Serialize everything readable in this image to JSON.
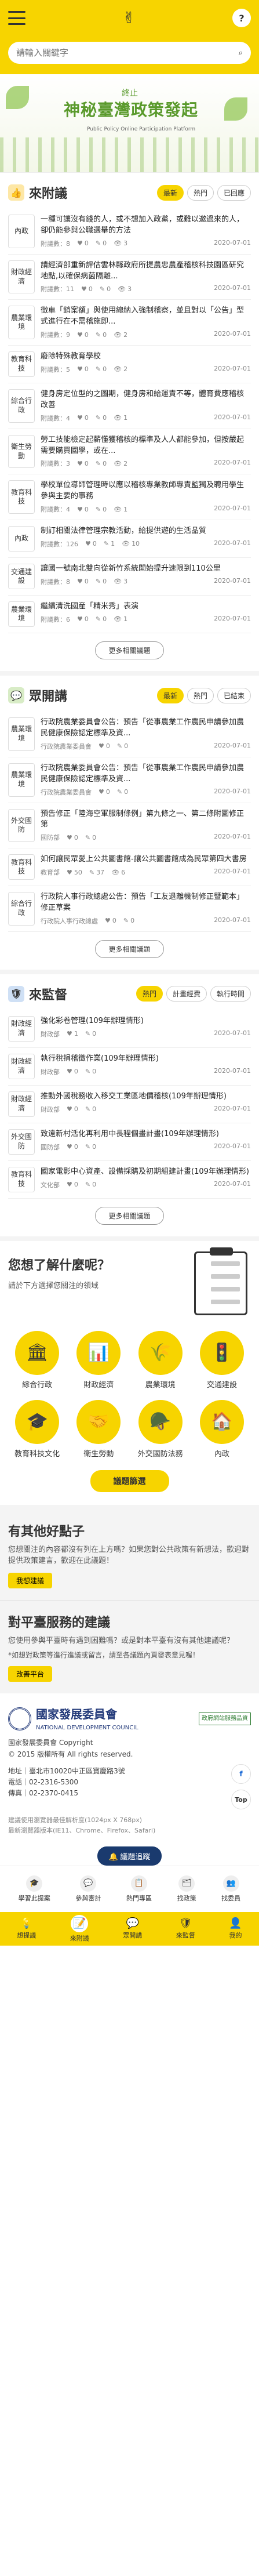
{
  "header": {
    "search_placeholder": "請輸入關鍵字",
    "login_label": "?"
  },
  "banner": {
    "title": "神秘臺灣政策發起",
    "small": "終止",
    "sub": "Public Policy Online Participation Platform"
  },
  "fuyi": {
    "title": "來附議",
    "tabs": [
      "最新",
      "熱門",
      "已回應"
    ],
    "more": "更多相關議題",
    "items": [
      {
        "cat": "內政",
        "title": "一種可讓沒有錢的人，或不想加入政黨，或難以邀過來的人，卻仍能參與公職選舉的方法",
        "user": "附議數：8",
        "a": "0",
        "b": "0",
        "c": "3",
        "date": "2020-07-01"
      },
      {
        "cat": "財政經濟",
        "title": "請經濟部重新評估雲林縣政府所提農忠農產稽核科技園區研究地點,以確保病菌隔離...",
        "user": "附議數：11",
        "a": "0",
        "b": "0",
        "c": "3",
        "date": "2020-07-01"
      },
      {
        "cat": "農業環境",
        "title": "徵車「銷案額」與使用總納入強制稽察，並且對以「公告」型式進行在不需稽施即...",
        "user": "附議數：9",
        "a": "0",
        "b": "0",
        "c": "2",
        "date": "2020-07-01"
      },
      {
        "cat": "教育科技",
        "title": "廢除特殊教育學校",
        "user": "附議數：5",
        "a": "0",
        "b": "0",
        "c": "2",
        "date": "2020-07-01"
      },
      {
        "cat": "綜合行政",
        "title": "健身房定位型的之圖期，健身房和給運責不等，體育費應稽核改善",
        "user": "附議數：4",
        "a": "0",
        "b": "0",
        "c": "1",
        "date": "2020-07-01"
      },
      {
        "cat": "衛生勞動",
        "title": "勞工技能檢定起薪懂獲稽核的標準及人人都能參加，但按嚴起需要購買國學，或在...",
        "user": "附議數：3",
        "a": "0",
        "b": "0",
        "c": "2",
        "date": "2020-07-01"
      },
      {
        "cat": "教育科技",
        "title": "學校單位導師管理時以應以稽核專業教師專責監獨及聘用學生參與主要的事務",
        "user": "附議數：4",
        "a": "0",
        "b": "0",
        "c": "1",
        "date": "2020-07-01"
      },
      {
        "cat": "內政",
        "title": "制訂相關法律管理宗教活動，給提供遊的生活品質",
        "user": "附議數：126",
        "a": "0",
        "b": "1",
        "c": "10",
        "date": "2020-07-01"
      },
      {
        "cat": "交通建設",
        "title": "讓國一號南北雙向從新竹系統開始提升速限到110公里",
        "user": "附議數：8",
        "a": "0",
        "b": "0",
        "c": "3",
        "date": "2020-07-01"
      },
      {
        "cat": "農業環境",
        "title": "繼續清洗國産「精米秀」表演",
        "user": "附議數：6",
        "a": "0",
        "b": "0",
        "c": "1",
        "date": "2020-07-01"
      }
    ]
  },
  "zhongyi": {
    "title": "眾開講",
    "tabs": [
      "最新",
      "熱門",
      "已結束"
    ],
    "more": "更多相關議題",
    "items": [
      {
        "cat": "農業環境",
        "title": "行政院農業委員會公告：預告「從事農業工作農民申請參加農民健康保險認定標準及資...",
        "user": "行政院農業委員會",
        "a": "0",
        "b": "0",
        "c": "",
        "date": "2020-07-01"
      },
      {
        "cat": "農業環境",
        "title": "行政院農業委員會公告：預告「從事農業工作農民申請參加農民健康保險認定標準及資...",
        "user": "行政院農業委員會",
        "a": "0",
        "b": "0",
        "c": "",
        "date": "2020-07-01"
      },
      {
        "cat": "外交國防",
        "title": "預告修正「陸海空軍服制條例」第九條之一、第二條附圖修正第",
        "user": "國防部",
        "a": "0",
        "b": "0",
        "c": "",
        "date": "2020-07-01"
      },
      {
        "cat": "教育科技",
        "title": "如何讓民眾愛上公共圖書館-讓公共圖書館成為民眾第四大書房",
        "user": "教育部",
        "a": "50",
        "b": "37",
        "c": "6",
        "date": "2020-07-01"
      },
      {
        "cat": "綜合行政",
        "title": "行政院人事行政總處公告：預告「工友退離機制修正暨範本」修正草案",
        "user": "行政院人事行政總處",
        "a": "0",
        "b": "0",
        "c": "",
        "date": "2020-07-01"
      }
    ]
  },
  "jiandu": {
    "title": "來監督",
    "tabs": [
      "熱門",
      "計畫經費",
      "執行時間"
    ],
    "more": "更多相關議題",
    "items": [
      {
        "cat": "財政經濟",
        "title": "強化彩卷管理(109年辦理情形)",
        "user": "財政部",
        "a": "1",
        "b": "0",
        "c": "",
        "date": "2020-07-01"
      },
      {
        "cat": "財政經濟",
        "title": "執行稅捐稽徵作業(109年辦理情形)",
        "user": "財政部",
        "a": "0",
        "b": "0",
        "c": "",
        "date": "2020-07-01"
      },
      {
        "cat": "財政經濟",
        "title": "推動外國稅務收入移交工業區地價稽核(109年辦理情形)",
        "user": "財政部",
        "a": "0",
        "b": "0",
        "c": "",
        "date": "2020-07-01"
      },
      {
        "cat": "外交國防",
        "title": "致遠新村活化再利用中長程個畫計畫(109年辦理情形)",
        "user": "國防部",
        "a": "0",
        "b": "0",
        "c": "",
        "date": "2020-07-01"
      },
      {
        "cat": "教育科技",
        "title": "國家電影中心資產、設備採購及初期組建計畫(109年辦理情形)",
        "user": "文化部",
        "a": "0",
        "b": "0",
        "c": "",
        "date": "2020-07-01"
      }
    ]
  },
  "know": {
    "title": "您想了解什麼呢？",
    "desc": "請於下方選擇您關注的領域",
    "cats": [
      {
        "icon": "🏛",
        "label": "綜合行政"
      },
      {
        "icon": "📊",
        "label": "財政經濟"
      },
      {
        "icon": "🌾",
        "label": "農業環境"
      },
      {
        "icon": "🚦",
        "label": "交通建設"
      },
      {
        "icon": "🎓",
        "label": "教育科技文化"
      },
      {
        "icon": "🤝",
        "label": "衛生勞動"
      },
      {
        "icon": "🪖",
        "label": "外交國防法務"
      },
      {
        "icon": "🏠",
        "label": "內政"
      }
    ],
    "button": "議題篩選"
  },
  "idea": {
    "title": "有其他好點子",
    "desc": "您想關注的內容都沒有列在上方嗎？如果您對公共政策有新想法，歡迎對提供政策建言，歡迎在此議題！",
    "button": "我想建議"
  },
  "suggest": {
    "title": "對平臺服務的建議",
    "desc": "您使用參與平臺時有遇到困難嗎？或是對本平臺有沒有其他建議呢？",
    "note": "*如想對政策等進行進議或留言，請至各議題內頁發表意見喔！",
    "button": "改善平台"
  },
  "footer": {
    "org": "國家發展委員會",
    "org_en": "NATIONAL DEVELOPMENT COUNCIL",
    "badge": "政府網站服務品質",
    "copy1": "國家發展委員會 Copyright",
    "copy2": "© 2015 版權所有 All rights reserved.",
    "addr": "地址｜臺北市10020中正區寶慶路3號",
    "tel": "電話｜02-2316-5300",
    "fax": "傳真｜02-2370-0415",
    "note": "建議使用瀏覽器最佳解析度(1024px X 768px)",
    "note2": "最新瀏覽器版本(IE11、Chrome、Firefox、Safari)",
    "tracker": "議題追蹤",
    "top": "Top"
  },
  "links": [
    {
      "icon": "🎓",
      "label": "學習此提案"
    },
    {
      "icon": "💬",
      "label": "參與審計"
    },
    {
      "icon": "📋",
      "label": "熱門專區"
    },
    {
      "icon": "🗂",
      "label": "找政策"
    },
    {
      "icon": "👥",
      "label": "找委員"
    }
  ],
  "nav": [
    {
      "icon": "💡",
      "label": "想提議"
    },
    {
      "icon": "📝",
      "label": "來附議"
    },
    {
      "icon": "💬",
      "label": "眾開講"
    },
    {
      "icon": "🛡",
      "label": "來監督"
    },
    {
      "icon": "👤",
      "label": "我的"
    }
  ]
}
